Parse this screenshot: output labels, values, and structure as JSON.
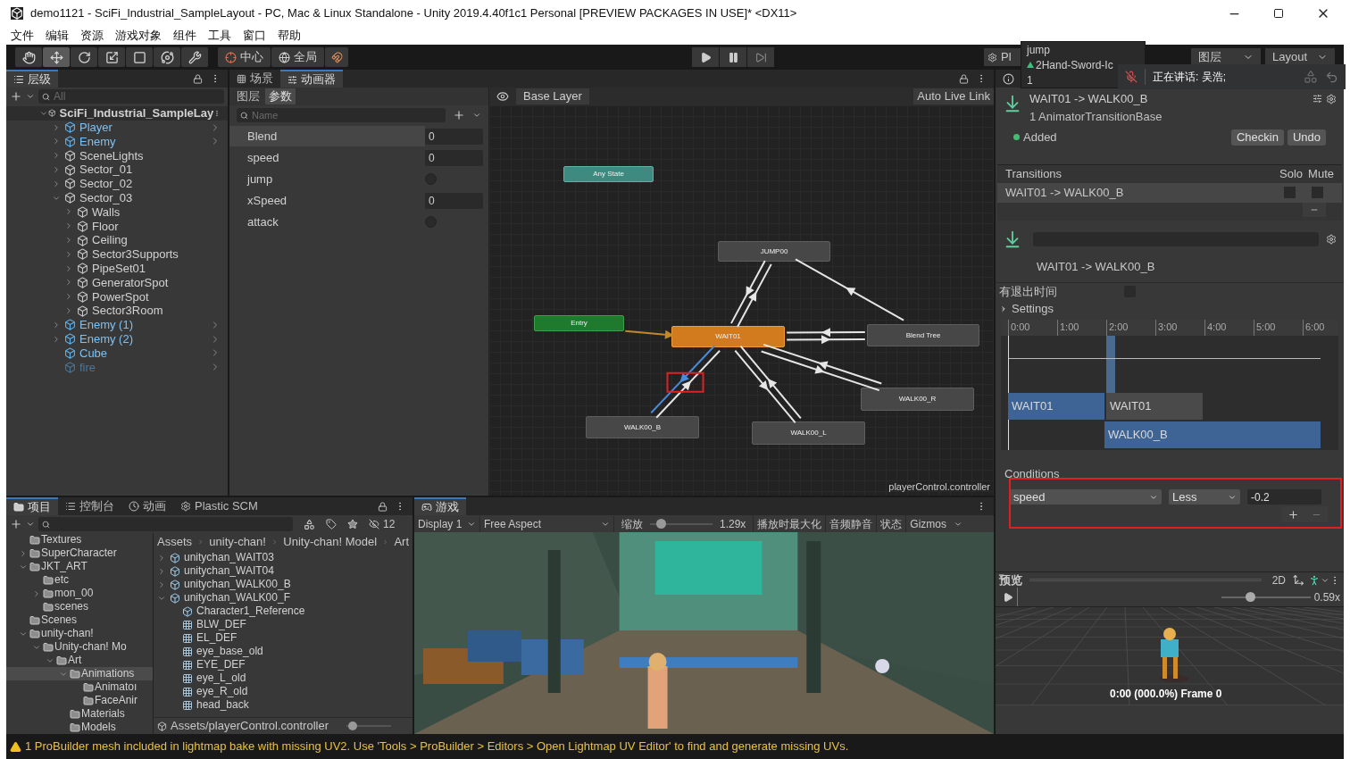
{
  "window": {
    "title": "demo1121 - SciFi_Industrial_SampleLayout - PC, Mac & Linux Standalone - Unity 2019.4.40f1c1 Personal [PREVIEW PACKAGES IN USE]* <DX11>"
  },
  "menu": [
    "文件",
    "编辑",
    "资源",
    "游戏对象",
    "组件",
    "工具",
    "窗口",
    "帮助"
  ],
  "toolbar": {
    "tools": [
      {
        "kind": "hand",
        "selected": false
      },
      {
        "kind": "move",
        "selected": true
      },
      {
        "kind": "rotate",
        "selected": false
      },
      {
        "kind": "scale",
        "selected": false
      },
      {
        "kind": "rect",
        "selected": false
      },
      {
        "kind": "transform",
        "selected": false
      },
      {
        "kind": "custom",
        "selected": false
      }
    ],
    "pivot": "中心",
    "space": "全局",
    "plastic": "Pl",
    "layers": "图层",
    "layout": "Layout"
  },
  "popup": {
    "items": [
      {
        "label": "jump",
        "kind": "text"
      },
      {
        "label": "2Hand-Sword-Ic",
        "kind": "asset"
      },
      {
        "label": "1",
        "kind": "text"
      }
    ]
  },
  "voice": {
    "speaking": "正在讲话: 吴浩;",
    "muted": true
  },
  "hierarchy": {
    "title": "层级",
    "search_placeholder": "All",
    "tree": [
      {
        "label": "SciFi_Industrial_SampleLay",
        "kind": "scene",
        "expanded": true,
        "disabled": false,
        "children": [
          {
            "label": "Player",
            "kind": "prefab",
            "expanded": false,
            "disabled": false
          },
          {
            "label": "Enemy",
            "kind": "prefab",
            "expanded": false,
            "disabled": false
          },
          {
            "label": "SceneLights",
            "kind": "object",
            "expanded": false,
            "disabled": false
          },
          {
            "label": "Sector_01",
            "kind": "object",
            "expanded": false,
            "disabled": false
          },
          {
            "label": "Sector_02",
            "kind": "object",
            "expanded": false,
            "disabled": false
          },
          {
            "label": "Sector_03",
            "kind": "object",
            "expanded": true,
            "disabled": false,
            "children": [
              {
                "label": "Walls",
                "kind": "object",
                "expanded": false,
                "disabled": false
              },
              {
                "label": "Floor",
                "kind": "object",
                "expanded": false,
                "disabled": false
              },
              {
                "label": "Ceiling",
                "kind": "object",
                "expanded": false,
                "disabled": false
              },
              {
                "label": "Sector3Supports",
                "kind": "object",
                "expanded": false,
                "disabled": false
              },
              {
                "label": "PipeSet01",
                "kind": "object",
                "expanded": false,
                "disabled": false
              },
              {
                "label": "GeneratorSpot",
                "kind": "object",
                "expanded": false,
                "disabled": false
              },
              {
                "label": "PowerSpot",
                "kind": "object",
                "expanded": false,
                "disabled": false
              },
              {
                "label": "Sector3Room",
                "kind": "object",
                "expanded": false,
                "disabled": false
              }
            ]
          },
          {
            "label": "Enemy (1)",
            "kind": "prefab",
            "expanded": false,
            "disabled": false
          },
          {
            "label": "Enemy (2)",
            "kind": "prefab",
            "expanded": false,
            "disabled": false
          },
          {
            "label": "Cube",
            "kind": "prefab",
            "disabled": false
          },
          {
            "label": "fire",
            "kind": "prefab",
            "disabled": true
          }
        ]
      }
    ]
  },
  "animator": {
    "tabs": [
      {
        "label": "场景",
        "selected": false
      },
      {
        "label": "动画器",
        "selected": true
      }
    ],
    "subtabs": [
      {
        "label": "图层",
        "selected": false
      },
      {
        "label": "参数",
        "selected": true
      }
    ],
    "search_placeholder": "Name",
    "breadcrumb": "Base Layer",
    "live_link": "Auto Live Link",
    "parameters": [
      {
        "name": "Blend",
        "kind": "float",
        "value": "0",
        "selected": true
      },
      {
        "name": "speed",
        "kind": "float",
        "value": "0",
        "selected": false
      },
      {
        "name": "jump",
        "kind": "bool",
        "checked": false,
        "selected": false
      },
      {
        "name": "xSpeed",
        "kind": "float",
        "value": "0",
        "selected": false
      },
      {
        "name": "attack",
        "kind": "trigger",
        "checked": false,
        "selected": false
      }
    ],
    "nodes": [
      {
        "label": "Any State",
        "kind": "any"
      },
      {
        "label": "JUMP00",
        "kind": "state"
      },
      {
        "label": "Entry",
        "kind": "entry"
      },
      {
        "label": "WAIT01",
        "kind": "default"
      },
      {
        "label": "Blend Tree",
        "kind": "state"
      },
      {
        "label": "WALK00_R",
        "kind": "state"
      },
      {
        "label": "WALK00_B",
        "kind": "state"
      },
      {
        "label": "WALK00_L",
        "kind": "state"
      }
    ],
    "transitions": [
      {
        "selected": false
      },
      {
        "selected": false
      },
      {
        "selected": false
      },
      {
        "selected": false
      },
      {
        "selected": false
      },
      {
        "selected": false
      },
      {
        "selected": false
      },
      {
        "selected": false
      },
      {
        "selected": false
      },
      {
        "selected": false
      },
      {
        "selected": true
      },
      {
        "selected": false
      }
    ],
    "selection_frame": true,
    "file": "playerControl.controller"
  },
  "inspector": {
    "title": "WAIT01 -> WALK00_B",
    "subtitle": "1 AnimatorTransitionBase",
    "status": "Added",
    "buttons": [
      "Checkin",
      "Undo"
    ],
    "transitions": {
      "title": "Transitions",
      "columns": [
        "Solo",
        "Mute"
      ],
      "rows": [
        {
          "label": "WAIT01 -> WALK00_B",
          "solo": false,
          "mute": false
        }
      ]
    },
    "transition_name": "WAIT01 -> WALK00_B",
    "exit_time_label": "有退出时间",
    "has_exit_time": false,
    "settings": "Settings",
    "settings_expanded": false,
    "timeline": {
      "ticks": [
        "0:00",
        "1:00",
        "2:00",
        "3:00",
        "4:00",
        "5:00",
        "6:00"
      ],
      "bars": [
        {
          "label": "WAIT01",
          "kind": "source"
        },
        {
          "label": "WAIT01",
          "kind": "source-rest"
        },
        {
          "label": "WALK00_B",
          "kind": "target"
        }
      ]
    },
    "conditions": {
      "title": "Conditions",
      "highlighted": true,
      "rows": [
        {
          "parameter": "speed",
          "mode": "Less",
          "value": "-0.2"
        }
      ]
    },
    "preview": {
      "title": "预览",
      "mode": "2D",
      "speed": "0.59x",
      "level": 0.3,
      "caption": "0:00 (000.0%) Frame 0"
    }
  },
  "project": {
    "tabs": [
      {
        "label": "项目",
        "kind": "folder",
        "selected": true
      },
      {
        "label": "控制台",
        "kind": "console",
        "selected": false
      },
      {
        "label": "动画",
        "kind": "clock",
        "selected": false
      },
      {
        "label": "Plastic SCM",
        "kind": "plastic",
        "selected": false
      }
    ],
    "hidden_count": "12",
    "folders": [
      {
        "label": "Textures",
        "selected": false
      },
      {
        "label": "SuperCharacter",
        "expanded": false,
        "selected": false
      },
      {
        "label": "JKT_ART",
        "expanded": true,
        "selected": false,
        "children": [
          {
            "label": "etc",
            "selected": false
          },
          {
            "label": "mon_00",
            "expanded": false,
            "selected": false
          },
          {
            "label": "scenes",
            "selected": false
          }
        ]
      },
      {
        "label": "Scenes",
        "selected": false
      },
      {
        "label": "unity-chan!",
        "expanded": true,
        "selected": false,
        "children": [
          {
            "label": "Unity-chan! Mo",
            "expanded": true,
            "selected": false,
            "children": [
              {
                "label": "Art",
                "expanded": true,
                "selected": false,
                "children": [
                  {
                    "label": "Animations",
                    "expanded": true,
                    "selected": true,
                    "children": [
                      {
                        "label": "Animatoı",
                        "selected": false
                      },
                      {
                        "label": "FaceAnir",
                        "selected": false
                      }
                    ]
                  },
                  {
                    "label": "Materials",
                    "selected": false
                  },
                  {
                    "label": "Models",
                    "selected": false
                  }
                ]
              }
            ]
          }
        ]
      }
    ],
    "breadcrumb": [
      "Assets",
      "unity-chan!",
      "Unity-chan! Model",
      "Art"
    ],
    "files": [
      {
        "label": "unitychan_WAIT03",
        "kind": "model",
        "expanded": false
      },
      {
        "label": "unitychan_WAIT04",
        "kind": "model",
        "expanded": false
      },
      {
        "label": "unitychan_WALK00_B",
        "kind": "model",
        "expanded": false
      },
      {
        "label": "unitychan_WALK00_F",
        "kind": "model",
        "expanded": true,
        "children": [
          {
            "label": "Character1_Reference",
            "kind": "model"
          },
          {
            "label": "BLW_DEF",
            "kind": "mesh"
          },
          {
            "label": "EL_DEF",
            "kind": "mesh"
          },
          {
            "label": "eye_base_old",
            "kind": "mesh"
          },
          {
            "label": "EYE_DEF",
            "kind": "mesh"
          },
          {
            "label": "eye_L_old",
            "kind": "mesh"
          },
          {
            "label": "eye_R_old",
            "kind": "mesh"
          },
          {
            "label": "head_back",
            "kind": "mesh"
          }
        ]
      }
    ],
    "path": "Assets/playerControl.controller",
    "level": 0.05
  },
  "game": {
    "tab": "游戏",
    "display": "Display 1",
    "aspect": "Free Aspect",
    "scale_label": "缩放",
    "scale": "1.29x",
    "level": 0.1,
    "toggles": [
      {
        "label": "播放时最大化",
        "on": false
      },
      {
        "label": "音频静音",
        "on": false
      },
      {
        "label": "状态",
        "on": false
      },
      {
        "label": "Gizmos",
        "on": false
      }
    ]
  },
  "status": {
    "message": "1 ProBuilder mesh included in lightmap bake with missing UV2. Use 'Tools > ProBuilder > Editors > Open Lightmap UV Editor' to find and generate missing UVs."
  }
}
